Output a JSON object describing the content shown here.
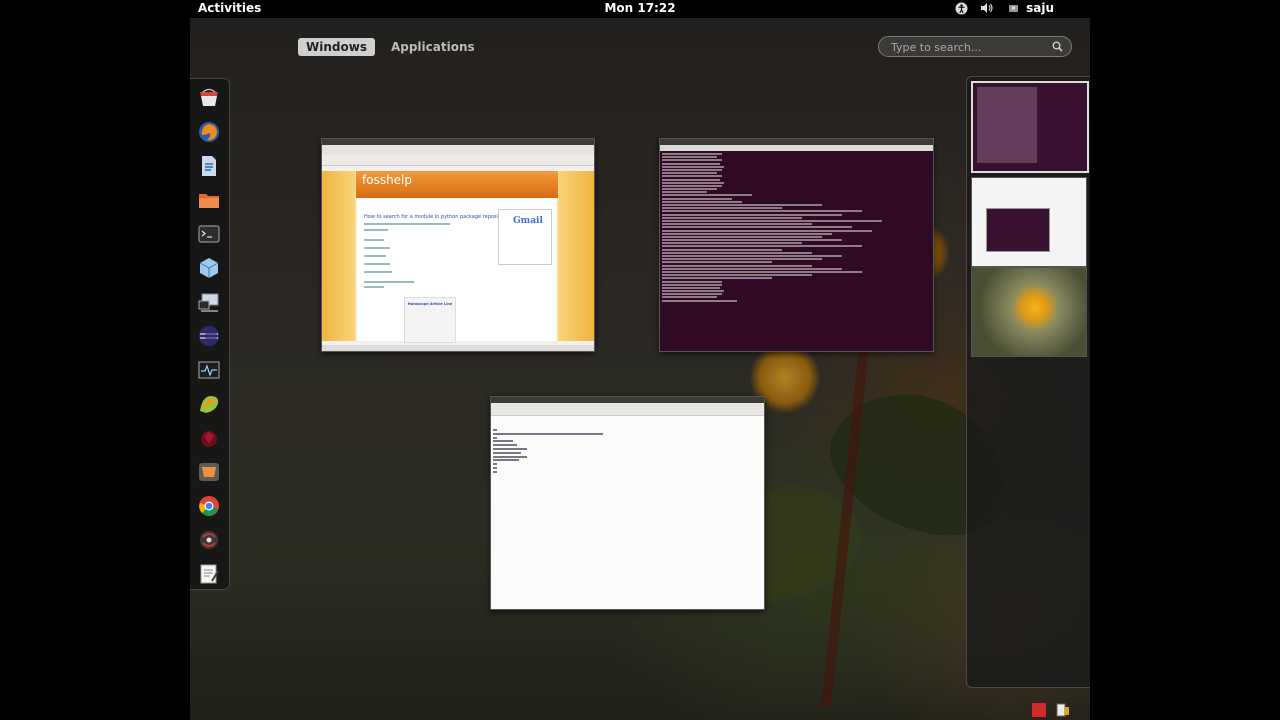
{
  "topbar": {
    "activities_label": "Activities",
    "clock": "Mon 17:22",
    "username": "saju",
    "icons": [
      "accessibility-icon",
      "volume-icon",
      "user-icon"
    ]
  },
  "overview": {
    "tabs": [
      {
        "label": "Windows",
        "active": true
      },
      {
        "label": "Applications",
        "active": false
      }
    ],
    "search": {
      "placeholder": "Type to search..."
    }
  },
  "dash": {
    "items": [
      "software-center-icon",
      "firefox-icon",
      "libreoffice-writer-icon",
      "file-manager-icon",
      "terminal-icon",
      "virtualbox-icon",
      "remote-desktop-icon",
      "eclipse-icon",
      "system-monitor-icon",
      "pycharm-icon",
      "ruby-icon",
      "sublime-text-icon",
      "chrome-icon",
      "bugzilla-icon",
      "text-editor-icon"
    ]
  },
  "windows": {
    "browser": {
      "blog_name": "fosshelp",
      "post_title": "How to search for a module in python package repository",
      "gmail_label": "Gmail",
      "ad_link": "Horoscope Article Line"
    },
    "terminal": {},
    "gedit": {}
  },
  "colors": {
    "terminal_bg": "#300a24",
    "blog_header": "#e27b1c",
    "accent": "#cfcfcf"
  }
}
